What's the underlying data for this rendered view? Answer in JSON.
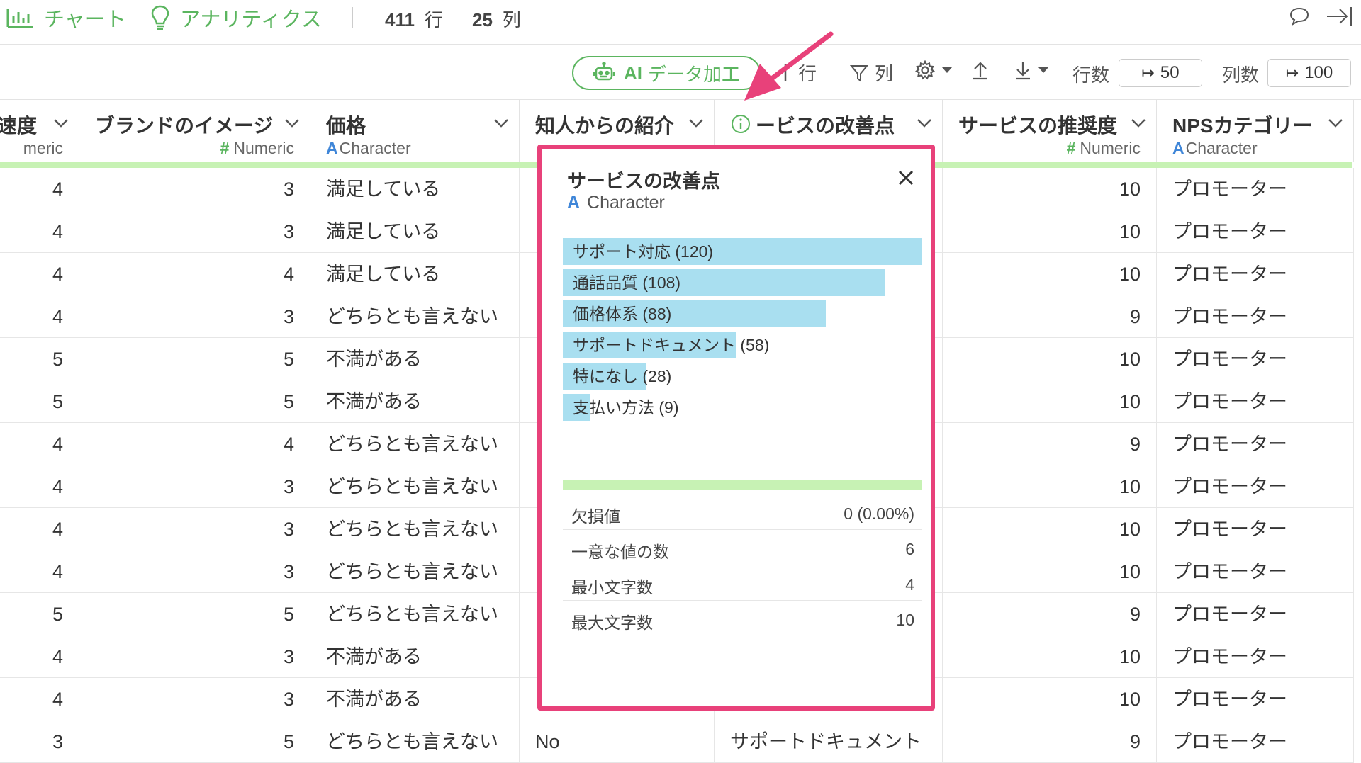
{
  "topbar": {
    "chart_label": "チャート",
    "analytics_label": "アナリティクス",
    "rows_count": "411",
    "rows_unit": "行",
    "cols_count": "25",
    "cols_unit": "列"
  },
  "toolbar": {
    "ai_prefix": "AI",
    "ai_label": "データ加工",
    "row_label": "行",
    "col_label": "列",
    "rows_field_label": "行数",
    "rows_value": "50",
    "cols_field_label": "列数",
    "cols_value": "100"
  },
  "columns": [
    {
      "name": "速度",
      "type_symbol": "",
      "type": "meric"
    },
    {
      "name": "ブランドのイメージ",
      "type_symbol": "#",
      "type": "Numeric"
    },
    {
      "name": "価格",
      "type_symbol": "A",
      "type": "Character"
    },
    {
      "name": "知人からの紹介",
      "type_symbol": "",
      "type": ""
    },
    {
      "name": "ービスの改善点",
      "type_symbol": "",
      "type": ""
    },
    {
      "name": "サービスの推奨度",
      "type_symbol": "#",
      "type": "Numeric"
    },
    {
      "name": "NPSカテゴリー",
      "type_symbol": "A",
      "type": "Character"
    }
  ],
  "rows": [
    [
      "4",
      "3",
      "満足している",
      "",
      "",
      "10",
      "プロモーター"
    ],
    [
      "4",
      "3",
      "満足している",
      "",
      "",
      "10",
      "プロモーター"
    ],
    [
      "4",
      "4",
      "満足している",
      "",
      "",
      "10",
      "プロモーター"
    ],
    [
      "4",
      "3",
      "どちらとも言えない",
      "",
      "",
      "9",
      "プロモーター"
    ],
    [
      "5",
      "5",
      "不満がある",
      "",
      "",
      "10",
      "プロモーター"
    ],
    [
      "5",
      "5",
      "不満がある",
      "",
      "",
      "10",
      "プロモーター"
    ],
    [
      "4",
      "4",
      "どちらとも言えない",
      "",
      "",
      "9",
      "プロモーター"
    ],
    [
      "4",
      "3",
      "どちらとも言えない",
      "",
      "",
      "10",
      "プロモーター"
    ],
    [
      "4",
      "3",
      "どちらとも言えない",
      "",
      "",
      "10",
      "プロモーター"
    ],
    [
      "4",
      "3",
      "どちらとも言えない",
      "",
      "",
      "10",
      "プロモーター"
    ],
    [
      "5",
      "5",
      "どちらとも言えない",
      "",
      "",
      "9",
      "プロモーター"
    ],
    [
      "4",
      "3",
      "不満がある",
      "",
      "",
      "10",
      "プロモーター"
    ],
    [
      "4",
      "3",
      "不満がある",
      "",
      "",
      "10",
      "プロモーター"
    ],
    [
      "3",
      "5",
      "どちらとも言えない",
      "No",
      "サポートドキュメント",
      "9",
      "プロモーター"
    ]
  ],
  "popup": {
    "title": "サービスの改善点",
    "type_symbol": "A",
    "type": "Character",
    "bars": [
      {
        "label": "サポート対応 (120)",
        "count": 120
      },
      {
        "label": "通話品質 (108)",
        "count": 108
      },
      {
        "label": "価格体系 (88)",
        "count": 88
      },
      {
        "label": "サポートドキュメント (58)",
        "count": 58
      },
      {
        "label": "特になし (28)",
        "count": 28
      },
      {
        "label": "支払い方法 (9)",
        "count": 9
      }
    ],
    "stats": [
      {
        "key": "欠損値",
        "value": "0 (0.00%)"
      },
      {
        "key": "一意な値の数",
        "value": "6"
      },
      {
        "key": "最小文字数",
        "value": "4"
      },
      {
        "key": "最大文字数",
        "value": "10"
      }
    ]
  },
  "colors": {
    "green": "#5bb55f",
    "highlight": "#e8417a",
    "bar": "#a9dff0",
    "quality_bar": "#c7f2b4",
    "character_blue": "#3f86d8"
  }
}
